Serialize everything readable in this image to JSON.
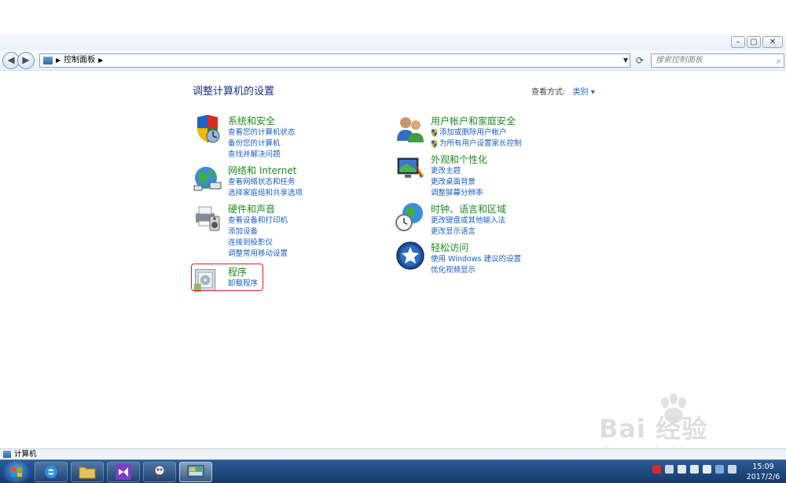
{
  "window": {
    "address_path": "控制面板",
    "search_placeholder": "搜索控制面板"
  },
  "content": {
    "title": "调整计算机的设置",
    "view_by_label": "查看方式:",
    "view_by_value": "类别"
  },
  "categories": [
    {
      "title": "系统和安全",
      "links": [
        "查看您的计算机状态",
        "备份您的计算机",
        "查找并解决问题"
      ],
      "icon": "shield-icon"
    },
    {
      "title": "网络和 Internet",
      "links": [
        "查看网络状态和任务",
        "选择家庭组和共享选项"
      ],
      "icon": "network-globe-icon"
    },
    {
      "title": "硬件和声音",
      "links": [
        "查看设备和打印机",
        "添加设备",
        "连接到投影仪",
        "调整常用移动设置"
      ],
      "icon": "printer-icon"
    },
    {
      "title": "程序",
      "links": [
        "卸载程序"
      ],
      "icon": "programs-icon"
    },
    {
      "title": "用户帐户和家庭安全",
      "links": [
        "添加或删除用户帐户",
        "为所有用户设置家长控制"
      ],
      "icon": "users-icon"
    },
    {
      "title": "外观和个性化",
      "links": [
        "更改主题",
        "更改桌面背景",
        "调整屏幕分辨率"
      ],
      "icon": "appearance-icon"
    },
    {
      "title": "时钟、语言和区域",
      "links": [
        "更改键盘或其他输入法",
        "更改显示语言"
      ],
      "icon": "clock-globe-icon"
    },
    {
      "title": "轻松访问",
      "links": [
        "使用 Windows 建议的设置",
        "优化视频显示"
      ],
      "icon": "ease-of-access-icon"
    }
  ],
  "statusbar": {
    "text": "计算机"
  },
  "watermark": {
    "brand": "Bai 经验",
    "url": "jingyan.baidu.com"
  },
  "taskbar": {
    "time": "15:09",
    "date": "2017/2/6"
  },
  "colors": {
    "category_title": "#1f8a1f",
    "link": "#1a5ec8",
    "heading": "#1e3287",
    "highlight": "#e02020"
  }
}
